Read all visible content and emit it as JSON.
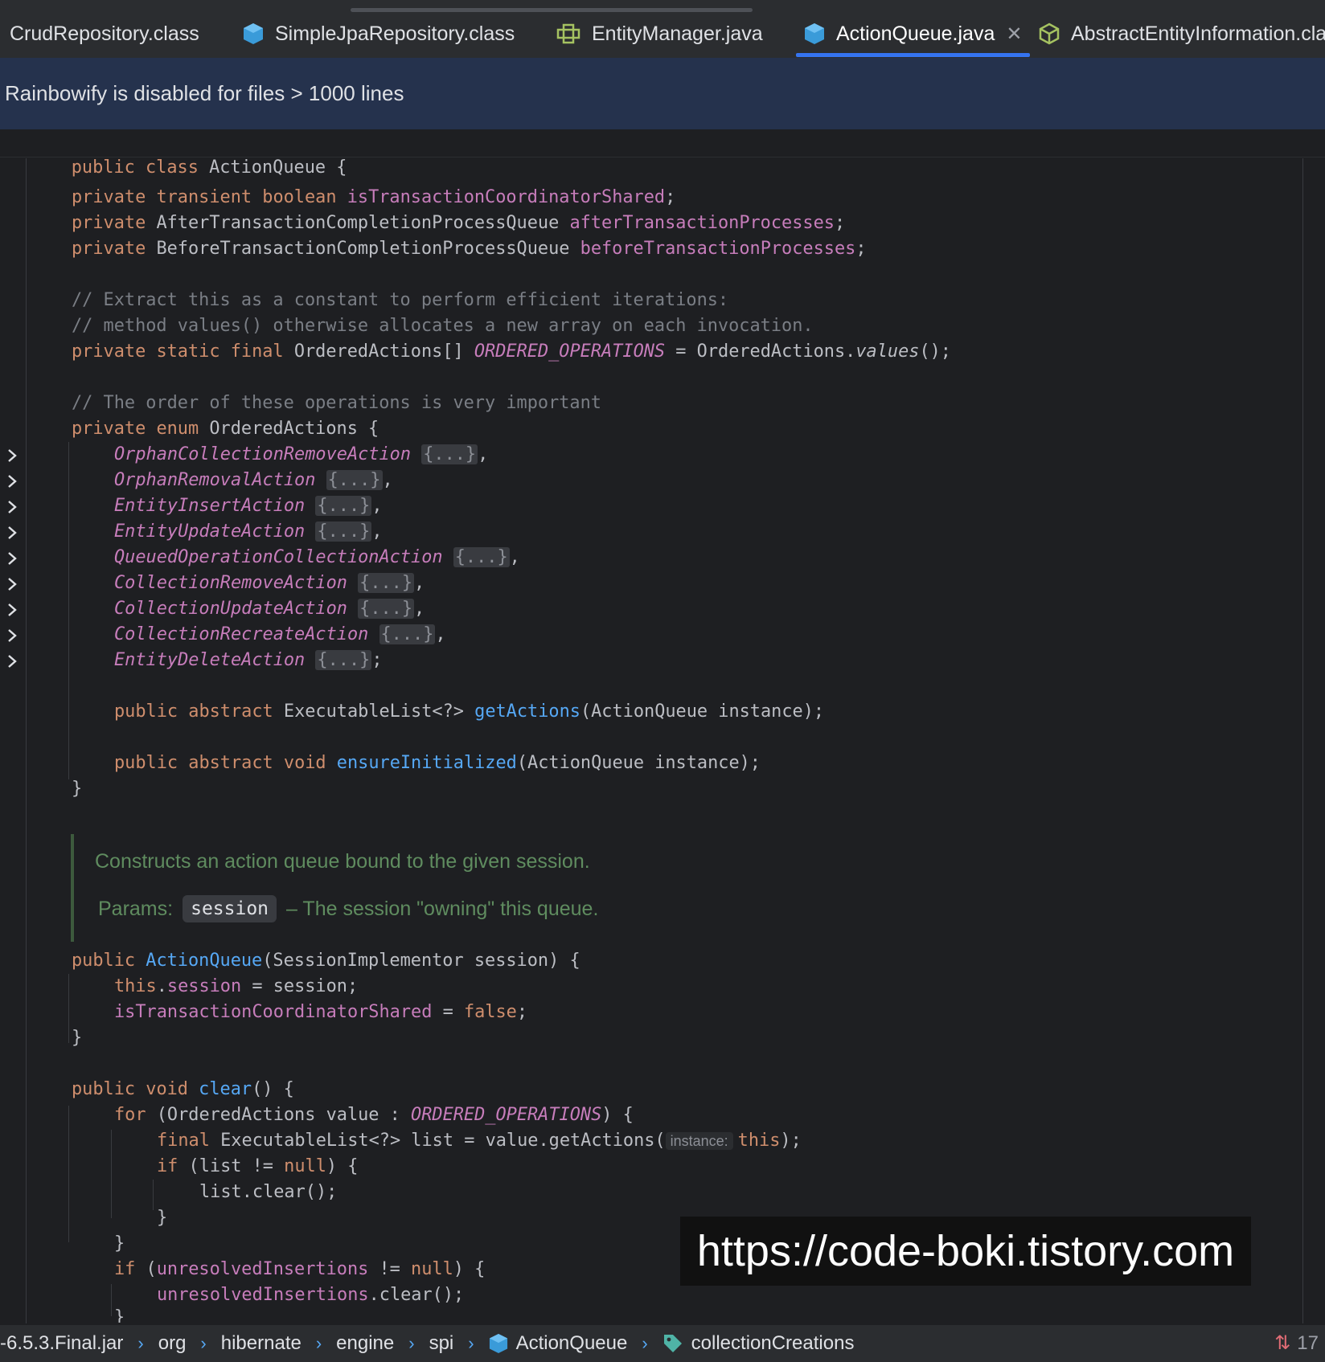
{
  "tabs": [
    {
      "label": "CrudRepository.class",
      "icon": "interface-icon"
    },
    {
      "label": "SimpleJpaRepository.class",
      "icon": "class-icon"
    },
    {
      "label": "EntityManager.java",
      "icon": "interface-icon"
    },
    {
      "label": "ActionQueue.java",
      "icon": "class-icon",
      "active": true
    },
    {
      "label": "AbstractEntityInformation.cla",
      "icon": "abstract-class-icon"
    }
  ],
  "banner": {
    "text": "Rainbowify is disabled for files > 1000 lines"
  },
  "code": {
    "sticky": [
      "public",
      "class",
      "ActionQueue {"
    ],
    "field1": [
      "private",
      "transient",
      "boolean",
      "isTransactionCoordinatorShared",
      ";"
    ],
    "field2": [
      "private",
      "AfterTransactionCompletionProcessQueue",
      "afterTransactionProcesses",
      ";"
    ],
    "field3": [
      "private",
      "BeforeTransactionCompletionProcessQueue",
      "beforeTransactionProcesses",
      ";"
    ],
    "comment1": "// Extract this as a constant to perform efficient iterations:",
    "comment2": "// method values() otherwise allocates a new array on each invocation.",
    "ordered_ops": [
      "private",
      "static",
      "final",
      "OrderedActions[]",
      "ORDERED_OPERATIONS",
      "= OrderedActions.",
      "values",
      "();"
    ],
    "comment3": "// The order of these operations is very important",
    "enum_decl": [
      "private",
      "enum",
      "OrderedActions {"
    ],
    "enum_items": [
      {
        "name": "OrphanCollectionRemoveAction",
        "fold": "{...}",
        "punct": ","
      },
      {
        "name": "OrphanRemovalAction",
        "fold": "{...}",
        "punct": ","
      },
      {
        "name": "EntityInsertAction",
        "fold": "{...}",
        "punct": ","
      },
      {
        "name": "EntityUpdateAction",
        "fold": "{...}",
        "punct": ","
      },
      {
        "name": "QueuedOperationCollectionAction",
        "fold": "{...}",
        "punct": ","
      },
      {
        "name": "CollectionRemoveAction",
        "fold": "{...}",
        "punct": ","
      },
      {
        "name": "CollectionUpdateAction",
        "fold": "{...}",
        "punct": ","
      },
      {
        "name": "CollectionRecreateAction",
        "fold": "{...}",
        "punct": ","
      },
      {
        "name": "EntityDeleteAction",
        "fold": "{...}",
        "punct": ";"
      }
    ],
    "get_actions": [
      "public",
      "abstract",
      "ExecutableList<?>",
      "getActions",
      "(ActionQueue instance);"
    ],
    "ensure_init": [
      "public",
      "abstract",
      "void",
      "ensureInitialized",
      "(ActionQueue instance);"
    ],
    "close_brace": "}",
    "doc": {
      "summary": "Constructs an action queue bound to the given session.",
      "params_label": "Params:",
      "param_name": "session",
      "param_desc": "– The session \"owning\" this queue."
    },
    "ctor": [
      "public",
      "ActionQueue",
      "(SessionImplementor session) {"
    ],
    "ctor_l1": [
      "this",
      ".",
      "session",
      " = session;"
    ],
    "ctor_l2": [
      "isTransactionCoordinatorShared",
      " = ",
      "false",
      ";"
    ],
    "clear_decl": [
      "public",
      "void",
      "clear",
      "() {"
    ],
    "for_line": [
      "for",
      " (OrderedActions value : ",
      "ORDERED_OPERATIONS",
      ") {"
    ],
    "list_line": [
      "final",
      " ExecutableList<?> list = value.getActions(",
      "instance:",
      "this",
      ");"
    ],
    "if_line": [
      "if",
      " (list != ",
      "null",
      ") {"
    ],
    "list_clear": "list.clear();",
    "if2_line": [
      "if",
      " (",
      "unresolvedInsertions",
      " != ",
      "null",
      ") {"
    ],
    "unresolved_clear": [
      "unresolvedInsertions",
      ".clear();"
    ],
    "partial": "}"
  },
  "watermark": "https://code-boki.tistory.com",
  "breadcrumb": [
    {
      "label": "-6.5.3.Final.jar"
    },
    {
      "label": "org"
    },
    {
      "label": "hibernate"
    },
    {
      "label": "engine"
    },
    {
      "label": "spi"
    },
    {
      "label": "ActionQueue",
      "icon": "class-icon"
    },
    {
      "label": "collectionCreations",
      "icon": "field-tag-icon"
    }
  ],
  "status": {
    "count": "17"
  },
  "colors": {
    "accent": "#3574f0",
    "keyword": "#cf8e6d",
    "field": "#c77dbb",
    "method": "#56a8f5",
    "comment": "#7a7e85"
  }
}
